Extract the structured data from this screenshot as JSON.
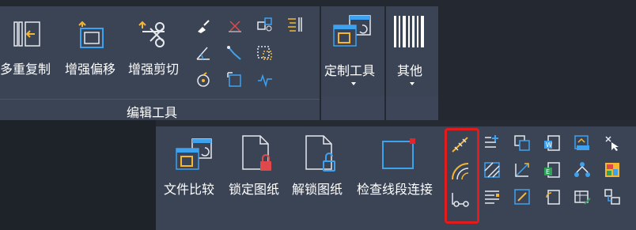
{
  "ribbon": {
    "edit_panel": {
      "title": "编辑工具",
      "buttons": [
        {
          "label": "多重复制",
          "icon": "multi-copy-icon"
        },
        {
          "label": "增强偏移",
          "icon": "enhanced-offset-icon"
        },
        {
          "label": "增强剪切",
          "icon": "enhanced-trim-icon"
        }
      ],
      "small_icons": [
        "brush-icon",
        "cross-icon",
        "shape-copy-icon",
        "text-align-icon",
        "angle-measure-icon",
        "curve-edit-icon",
        "selection-window-icon",
        "rotate-icon",
        "dimension-box-icon",
        "wave-icon"
      ]
    },
    "custom_panel": {
      "label": "定制工具",
      "icon": "custom-tool-icon"
    },
    "other_panel": {
      "label": "其他",
      "icon": "barcode-icon"
    }
  },
  "submenu": {
    "buttons": [
      {
        "label": "文件比较",
        "icon": "file-compare-icon"
      },
      {
        "label": "锁定图纸",
        "icon": "lock-drawing-icon"
      },
      {
        "label": "解锁图纸",
        "icon": "unlock-drawing-icon"
      },
      {
        "label": "检查线段连接",
        "icon": "check-line-icon"
      }
    ],
    "highlighted_icons": [
      "measure-line-icon",
      "arc-offset-icon",
      "node-connect-icon"
    ],
    "grid_icons": [
      "list-add-icon",
      "copy-layer-icon",
      "word-doc-icon",
      "pdf-convert-icon",
      "cursor-pick-icon",
      "hatch-icon",
      "dimension-align-icon",
      "excel-table-icon",
      "network-icon",
      "image-map-icon",
      "text-list-icon",
      "pen-edit-icon",
      "page-rotate-icon",
      "table-edit-icon",
      "block-link-icon"
    ],
    "highlight_color": "#e21c1c"
  }
}
